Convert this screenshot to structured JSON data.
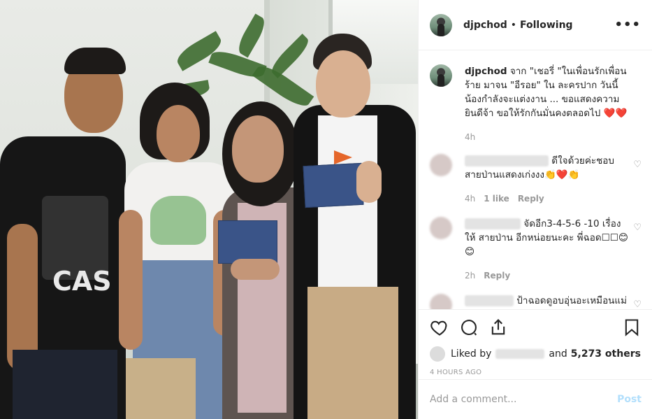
{
  "post": {
    "username": "djpchod",
    "follow_status": "Following",
    "separator": "•",
    "more_label": "•••"
  },
  "caption": {
    "username": "djpchod",
    "text": "จาก \"เชอรี่ \"ในเพื่อนรักเพื่อนร้าย มาจน \"อีรอย\" ใน ละครปาก วันนี้น้องกำลังจะแต่งงาน ... ขอแสดงความยินดีจ้า ขอให้รักกันมั่นคงตลอดไป ❤️❤️",
    "time": "4h"
  },
  "comments": [
    {
      "text": "ดีใจด้วยค่ะชอบสายป่านแสดงเก่งงง👏❤️👏",
      "time": "4h",
      "likes": "1 like",
      "reply": "Reply"
    },
    {
      "text": "จัดอีก3-4-5-6 -10 เรื่อง ให้ สายป่าน อีกหน่อยนะคะ พี่ฉอด☐☐😊😊",
      "time": "2h",
      "reply": "Reply"
    },
    {
      "text": "ป้าฉอดดูอบอุ่นอะเหมือนแม่กันเลย ชอบภาพ"
    }
  ],
  "likes": {
    "prefix": "Liked by",
    "middle": "and",
    "count": "5,273 others"
  },
  "timestamp": "4 HOURS AGO",
  "add_comment": {
    "placeholder": "Add a comment...",
    "post_label": "Post"
  },
  "icons": {
    "like": "heart-icon",
    "comment": "comment-icon",
    "share": "share-icon",
    "save": "bookmark-icon",
    "more": "more-options-icon"
  },
  "colors": {
    "link_blue_disabled": "#b2dffc",
    "muted": "#999999",
    "heart": "#e0245e"
  }
}
